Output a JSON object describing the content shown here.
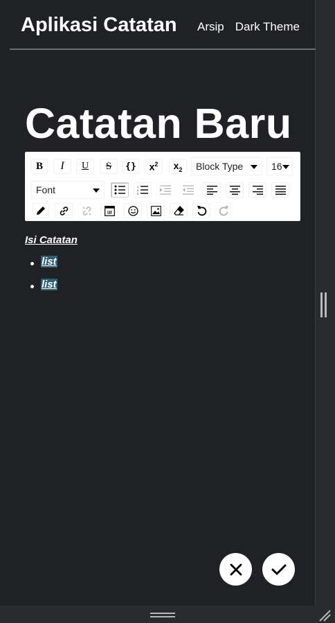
{
  "header": {
    "brand": "Aplikasi Catatan",
    "nav": [
      {
        "label": "Arsip"
      },
      {
        "label": "Dark Theme"
      }
    ]
  },
  "page": {
    "title": "Catatan Baru"
  },
  "toolbar": {
    "inline": [
      {
        "name": "bold",
        "icon": "bold-icon",
        "glyph": "B"
      },
      {
        "name": "italic",
        "icon": "italic-icon",
        "glyph": "I"
      },
      {
        "name": "underline",
        "icon": "underline-icon",
        "glyph": "U"
      },
      {
        "name": "strikethrough",
        "icon": "strikethrough-icon",
        "glyph": "S"
      },
      {
        "name": "monospace",
        "icon": "code-icon",
        "glyph": "{ }"
      },
      {
        "name": "superscript",
        "icon": "superscript-icon",
        "glyph": "x²"
      },
      {
        "name": "subscript",
        "icon": "subscript-icon",
        "glyph": "x₂"
      }
    ],
    "block_type": "Block Type",
    "font_size": "16",
    "font_family": "Font",
    "list_icons": [
      "unordered-list-icon",
      "ordered-list-icon",
      "indent-icon",
      "outdent-icon"
    ],
    "align_icons": [
      "align-left-icon",
      "align-center-icon",
      "align-right-icon",
      "align-justify-icon"
    ],
    "misc_icons": [
      "color-picker-icon",
      "link-icon",
      "unlink-icon",
      "embed-icon",
      "emoji-icon",
      "image-icon",
      "eraser-icon",
      "undo-icon",
      "redo-icon"
    ],
    "active": [
      "unordered-list"
    ]
  },
  "editor": {
    "paragraph": "Isi Catatan",
    "list_items": [
      "list",
      "list"
    ]
  },
  "actions": {
    "cancel_icon": "close-icon",
    "save_icon": "check-icon"
  },
  "colors": {
    "background": "#202125",
    "frame": "#2a2b2f",
    "text": "#ffffff",
    "selection": "#2f5f73"
  }
}
